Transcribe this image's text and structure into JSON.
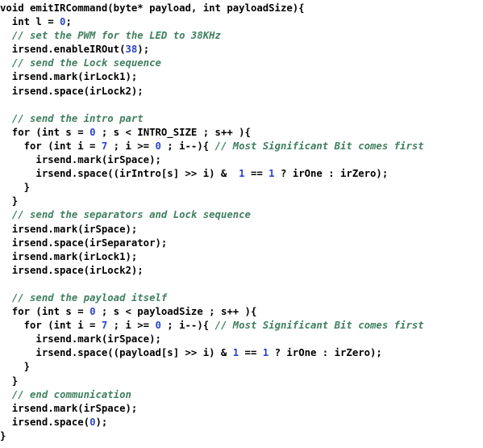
{
  "editor": {
    "background_color": "#ffffff",
    "language": "cpp",
    "font_weight": "bold",
    "colors": {
      "plain": "#000000",
      "number": "#2a43cf",
      "comment": "#3f7f5f"
    }
  },
  "code": {
    "title": "emitIRCommand",
    "lines": [
      {
        "index": 1,
        "text": "void emitIRCommand(byte* payload, int payloadSize){",
        "tokens": [
          {
            "t": "void emitIRCommand(byte* payload, int payloadSize){",
            "c": "plain"
          }
        ]
      },
      {
        "index": 2,
        "text": "  int l = 0;",
        "tokens": [
          {
            "t": "  int l = ",
            "c": "plain"
          },
          {
            "t": "0",
            "c": "number"
          },
          {
            "t": ";",
            "c": "plain"
          }
        ]
      },
      {
        "index": 3,
        "text": "  // set the PWM for the LED to 38KHz",
        "tokens": [
          {
            "t": "  ",
            "c": "plain"
          },
          {
            "t": "// set the PWM for the LED to 38KHz",
            "c": "comment"
          }
        ]
      },
      {
        "index": 4,
        "text": "  irsend.enableIROut(38);",
        "tokens": [
          {
            "t": "  irsend.enableIROut(",
            "c": "plain"
          },
          {
            "t": "38",
            "c": "number"
          },
          {
            "t": ");",
            "c": "plain"
          }
        ]
      },
      {
        "index": 5,
        "text": "  // send the Lock sequence",
        "tokens": [
          {
            "t": "  ",
            "c": "plain"
          },
          {
            "t": "// send the Lock sequence",
            "c": "comment"
          }
        ]
      },
      {
        "index": 6,
        "text": "  irsend.mark(irLock1);",
        "tokens": [
          {
            "t": "  irsend.mark(irLock1);",
            "c": "plain"
          }
        ]
      },
      {
        "index": 7,
        "text": "  irsend.space(irLock2);",
        "tokens": [
          {
            "t": "  irsend.space(irLock2);",
            "c": "plain"
          }
        ]
      },
      {
        "index": 8,
        "text": "",
        "tokens": []
      },
      {
        "index": 9,
        "text": "  // send the intro part",
        "tokens": [
          {
            "t": "  ",
            "c": "plain"
          },
          {
            "t": "// send the intro part",
            "c": "comment"
          }
        ]
      },
      {
        "index": 10,
        "text": "  for (int s = 0 ; s < INTRO_SIZE ; s++ ){",
        "tokens": [
          {
            "t": "  for (int s = ",
            "c": "plain"
          },
          {
            "t": "0",
            "c": "number"
          },
          {
            "t": " ; s < INTRO_SIZE ; s++ ){",
            "c": "plain"
          }
        ]
      },
      {
        "index": 11,
        "text": "    for (int i = 7 ; i >= 0 ; i--){ // Most Significant Bit comes first",
        "tokens": [
          {
            "t": "    for (int i = ",
            "c": "plain"
          },
          {
            "t": "7",
            "c": "number"
          },
          {
            "t": " ; i >= ",
            "c": "plain"
          },
          {
            "t": "0",
            "c": "number"
          },
          {
            "t": " ; i--){ ",
            "c": "plain"
          },
          {
            "t": "// Most Significant Bit comes first",
            "c": "comment"
          }
        ]
      },
      {
        "index": 12,
        "text": "      irsend.mark(irSpace);",
        "tokens": [
          {
            "t": "      irsend.mark(irSpace);",
            "c": "plain"
          }
        ]
      },
      {
        "index": 13,
        "text": "      irsend.space((irIntro[s] >> i) &  1 == 1 ? irOne : irZero);",
        "tokens": [
          {
            "t": "      irsend.space((irIntro[s] >> i) &  ",
            "c": "plain"
          },
          {
            "t": "1",
            "c": "number"
          },
          {
            "t": " == ",
            "c": "plain"
          },
          {
            "t": "1",
            "c": "number"
          },
          {
            "t": " ? irOne : irZero);",
            "c": "plain"
          }
        ]
      },
      {
        "index": 14,
        "text": "    }",
        "tokens": [
          {
            "t": "    }",
            "c": "plain"
          }
        ]
      },
      {
        "index": 15,
        "text": "  }",
        "tokens": [
          {
            "t": "  }",
            "c": "plain"
          }
        ]
      },
      {
        "index": 16,
        "text": "  // send the separators and Lock sequence",
        "tokens": [
          {
            "t": "  ",
            "c": "plain"
          },
          {
            "t": "// send the separators and Lock sequence",
            "c": "comment"
          }
        ]
      },
      {
        "index": 17,
        "text": "  irsend.mark(irSpace);",
        "tokens": [
          {
            "t": "  irsend.mark(irSpace);",
            "c": "plain"
          }
        ]
      },
      {
        "index": 18,
        "text": "  irsend.space(irSeparator);",
        "tokens": [
          {
            "t": "  irsend.space(irSeparator);",
            "c": "plain"
          }
        ]
      },
      {
        "index": 19,
        "text": "  irsend.mark(irLock1);",
        "tokens": [
          {
            "t": "  irsend.mark(irLock1);",
            "c": "plain"
          }
        ]
      },
      {
        "index": 20,
        "text": "  irsend.space(irLock2);",
        "tokens": [
          {
            "t": "  irsend.space(irLock2);",
            "c": "plain"
          }
        ]
      },
      {
        "index": 21,
        "text": "",
        "tokens": []
      },
      {
        "index": 22,
        "text": "  // send the payload itself",
        "tokens": [
          {
            "t": "  ",
            "c": "plain"
          },
          {
            "t": "// send the payload itself",
            "c": "comment"
          }
        ]
      },
      {
        "index": 23,
        "text": "  for (int s = 0 ; s < payloadSize ; s++ ){",
        "tokens": [
          {
            "t": "  for (int s = ",
            "c": "plain"
          },
          {
            "t": "0",
            "c": "number"
          },
          {
            "t": " ; s < payloadSize ; s++ ){",
            "c": "plain"
          }
        ]
      },
      {
        "index": 24,
        "text": "    for (int i = 7 ; i >= 0 ; i--){ // Most Significant Bit comes first",
        "tokens": [
          {
            "t": "    for (int i = ",
            "c": "plain"
          },
          {
            "t": "7",
            "c": "number"
          },
          {
            "t": " ; i >= ",
            "c": "plain"
          },
          {
            "t": "0",
            "c": "number"
          },
          {
            "t": " ; i--){ ",
            "c": "plain"
          },
          {
            "t": "// Most Significant Bit comes first",
            "c": "comment"
          }
        ]
      },
      {
        "index": 25,
        "text": "      irsend.mark(irSpace);",
        "tokens": [
          {
            "t": "      irsend.mark(irSpace);",
            "c": "plain"
          }
        ]
      },
      {
        "index": 26,
        "text": "      irsend.space((payload[s] >> i) & 1 == 1 ? irOne : irZero);",
        "tokens": [
          {
            "t": "      irsend.space((payload[s] >> i) & ",
            "c": "plain"
          },
          {
            "t": "1",
            "c": "number"
          },
          {
            "t": " == ",
            "c": "plain"
          },
          {
            "t": "1",
            "c": "number"
          },
          {
            "t": " ? irOne : irZero);",
            "c": "plain"
          }
        ]
      },
      {
        "index": 27,
        "text": "    }",
        "tokens": [
          {
            "t": "    }",
            "c": "plain"
          }
        ]
      },
      {
        "index": 28,
        "text": "  }",
        "tokens": [
          {
            "t": "  }",
            "c": "plain"
          }
        ]
      },
      {
        "index": 29,
        "text": "  // end communication",
        "tokens": [
          {
            "t": "  ",
            "c": "plain"
          },
          {
            "t": "// end communication",
            "c": "comment"
          }
        ]
      },
      {
        "index": 30,
        "text": "  irsend.mark(irSpace);",
        "tokens": [
          {
            "t": "  irsend.mark(irSpace);",
            "c": "plain"
          }
        ]
      },
      {
        "index": 31,
        "text": "  irsend.space(0);",
        "tokens": [
          {
            "t": "  irsend.space(",
            "c": "plain"
          },
          {
            "t": "0",
            "c": "number"
          },
          {
            "t": ");",
            "c": "plain"
          }
        ]
      },
      {
        "index": 32,
        "text": "}",
        "tokens": [
          {
            "t": "}",
            "c": "plain"
          }
        ]
      }
    ]
  }
}
